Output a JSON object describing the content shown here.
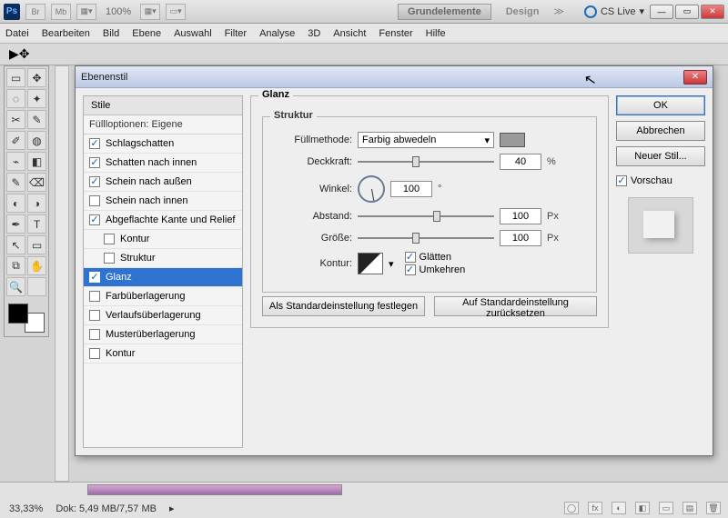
{
  "appbar": {
    "zoom": "100%",
    "tab1": "Grundelemente",
    "tab2": "Design",
    "cslive": "CS Live"
  },
  "menu": [
    "Datei",
    "Bearbeiten",
    "Bild",
    "Ebene",
    "Auswahl",
    "Filter",
    "Analyse",
    "3D",
    "Ansicht",
    "Fenster",
    "Hilfe"
  ],
  "dialog": {
    "title": "Ebenenstil",
    "styles_header": "Stile",
    "fill_options": "Füllloptionen: Eigene",
    "items": [
      {
        "label": "Schlagschatten",
        "checked": true,
        "indent": false
      },
      {
        "label": "Schatten nach innen",
        "checked": true,
        "indent": false
      },
      {
        "label": "Schein nach außen",
        "checked": true,
        "indent": false
      },
      {
        "label": "Schein nach innen",
        "checked": false,
        "indent": false
      },
      {
        "label": "Abgeflachte Kante und Relief",
        "checked": true,
        "indent": false
      },
      {
        "label": "Kontur",
        "checked": false,
        "indent": true
      },
      {
        "label": "Struktur",
        "checked": false,
        "indent": true
      },
      {
        "label": "Glanz",
        "checked": true,
        "indent": false,
        "selected": true
      },
      {
        "label": "Farbüberlagerung",
        "checked": false,
        "indent": false
      },
      {
        "label": "Verlaufsüberlagerung",
        "checked": false,
        "indent": false
      },
      {
        "label": "Musterüberlagerung",
        "checked": false,
        "indent": false
      },
      {
        "label": "Kontur",
        "checked": false,
        "indent": false
      }
    ],
    "section": "Glanz",
    "group": "Struktur",
    "blend_label": "Füllmethode:",
    "blend_value": "Farbig abwedeln",
    "opacity_label": "Deckkraft:",
    "opacity_value": "40",
    "opacity_unit": "%",
    "angle_label": "Winkel:",
    "angle_value": "100",
    "angle_unit": "°",
    "distance_label": "Abstand:",
    "distance_value": "100",
    "distance_unit": "Px",
    "size_label": "Größe:",
    "size_value": "100",
    "size_unit": "Px",
    "contour_label": "Kontur:",
    "antialias": "Glätten",
    "invert": "Umkehren",
    "btn_default_set": "Als Standardeinstellung festlegen",
    "btn_default_reset": "Auf Standardeinstellung zurücksetzen",
    "ok": "OK",
    "cancel": "Abbrechen",
    "new_style": "Neuer Stil...",
    "preview": "Vorschau"
  },
  "status": {
    "zoom": "33,33%",
    "doc": "Dok: 5,49 MB/7,57 MB"
  }
}
